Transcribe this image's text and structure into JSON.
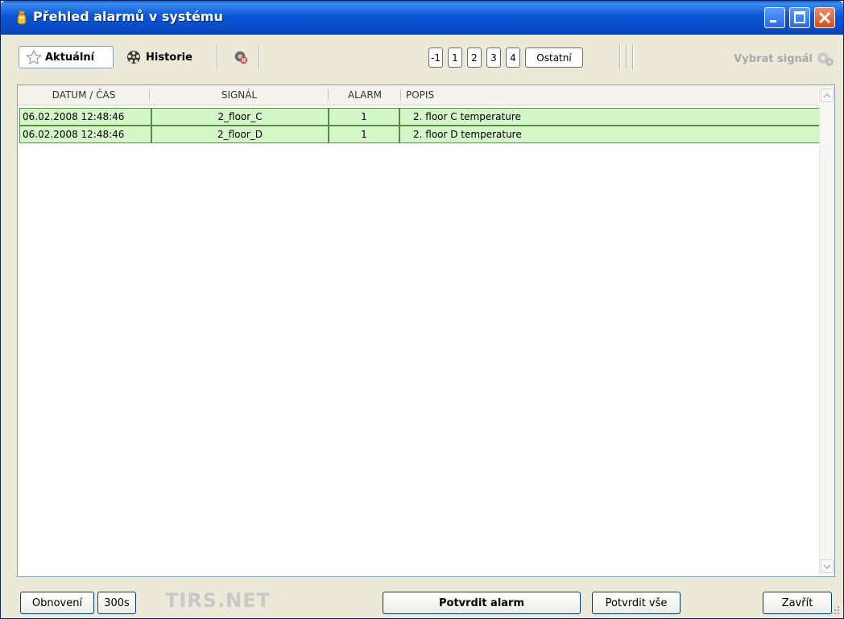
{
  "window": {
    "title": "Přehled alarmů v systému"
  },
  "toolbar": {
    "current_label": "Aktuální",
    "history_label": "Historie",
    "pages": [
      "-1",
      "1",
      "2",
      "3",
      "4",
      "Ostatní"
    ],
    "select_signal_label": "Vybrat signál"
  },
  "table": {
    "columns": [
      "DATUM / ČAS",
      "SIGNÁL",
      "ALARM",
      "POPIS"
    ],
    "rows": [
      {
        "datetime": "06.02.2008 12:48:46",
        "signal": "2_floor_C",
        "alarm": "1",
        "description": "2. floor C temperature"
      },
      {
        "datetime": "06.02.2008 12:48:46",
        "signal": "2_floor_D",
        "alarm": "1",
        "description": "2. floor D temperature"
      }
    ],
    "row_color": "#d4f7c8"
  },
  "bottom": {
    "refresh_label": "Obnovení",
    "interval_label": "300s",
    "brand": "TIRS.NET",
    "confirm_label": "Potvrdit alarm",
    "confirm_all_label": "Potvrdit vše",
    "close_label": "Zavřít"
  },
  "colors": {
    "titlebar": "#0b55d6",
    "accent_green": "#d4f7c8",
    "frame": "#ece9d8"
  }
}
